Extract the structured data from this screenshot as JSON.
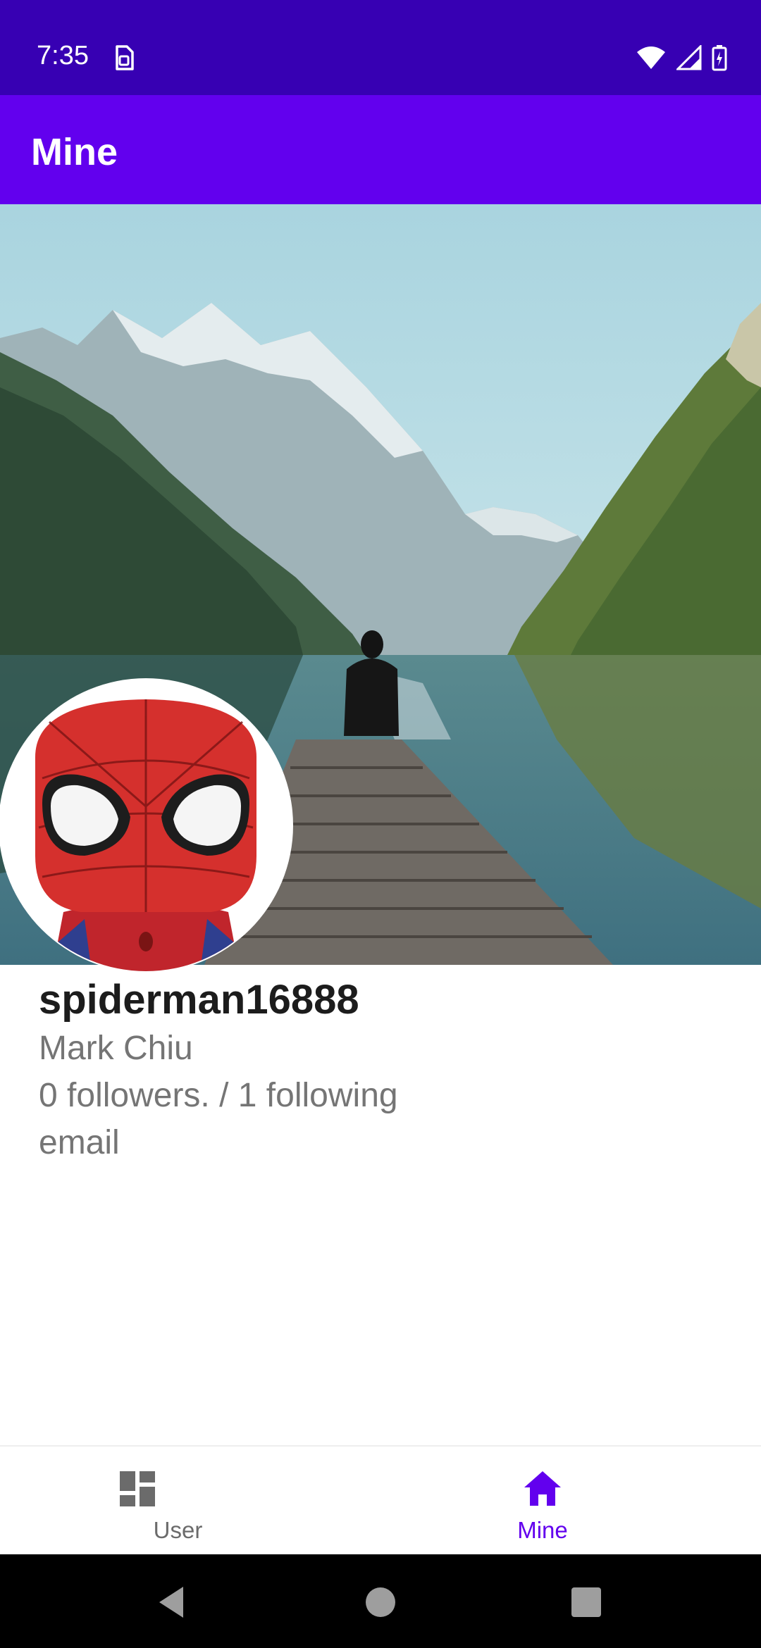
{
  "status_bar": {
    "time": "7:35",
    "notification_icon": "sim-card-icon",
    "icons": [
      "wifi-icon",
      "signal-icon",
      "battery-charging-icon"
    ]
  },
  "app_bar": {
    "title": "Mine"
  },
  "profile": {
    "cover_image": "lake-mountains-cover",
    "avatar_image": "spiderman-avatar",
    "username": "spiderman16888",
    "full_name": "Mark Chiu",
    "follow_stats": "0 followers. / 1 following",
    "email": "email"
  },
  "bottom_nav": {
    "items": [
      {
        "label": "User",
        "icon": "dashboard-icon",
        "selected": false
      },
      {
        "label": "Mine",
        "icon": "home-icon",
        "selected": true
      }
    ]
  },
  "system_nav": [
    "back-icon",
    "home-circle-icon",
    "recents-icon"
  ],
  "colors": {
    "status_bar": "#3700b3",
    "primary": "#6200ee",
    "text_primary": "#1c1c1c",
    "text_secondary": "#757575",
    "nav_inactive": "#6b6b6b"
  }
}
